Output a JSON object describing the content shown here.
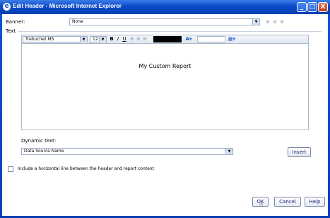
{
  "window": {
    "title": "Edit Header - Microsoft Internet Explorer",
    "minimize": "_",
    "maximize": "□",
    "close": "X"
  },
  "banner": {
    "label": "Banner:",
    "value": "None"
  },
  "text_group": {
    "label": "Text"
  },
  "toolbar": {
    "font": "Trebuchet MS",
    "size": "12",
    "bold": "B",
    "italic": "I",
    "underline": "U",
    "font_color": "#000000"
  },
  "editor": {
    "content": "My Custom Report"
  },
  "dynamic": {
    "label": "Dynamic text:",
    "value": "Data Source Name",
    "insert_label": "Insert"
  },
  "option": {
    "label": "Include a horizontal line between the header and report content",
    "checked": false
  },
  "buttons": {
    "ok": "OK",
    "cancel": "Cancel",
    "help": "Help"
  }
}
